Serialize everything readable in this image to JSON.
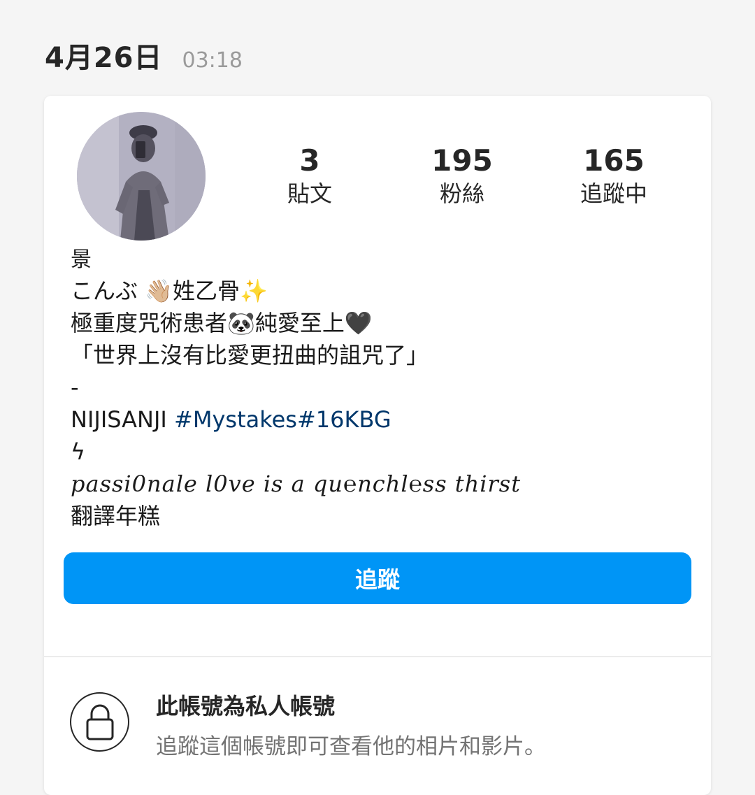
{
  "header": {
    "date": "4月26日",
    "time": "03:18"
  },
  "profile": {
    "avatar_icon": "profile-photo",
    "stats": {
      "posts_count": "3",
      "posts_label": "貼文",
      "followers_count": "195",
      "followers_label": "粉絲",
      "following_count": "165",
      "following_label": "追蹤中"
    },
    "bio": {
      "name": "景",
      "line1": "こんぶ 👋🏼姓乙骨✨",
      "line2": "極重度咒術患者🐼純愛至上🖤",
      "line3": "「世界上沒有比愛更扭曲的詛咒了」",
      "line4": "-",
      "line5_prefix": "NIJISANJI ",
      "line5_hashtags": "#Mystakes#16KBG",
      "line6": "ϟ",
      "line7": "passi0nale l0ve is a qu℮nchl℮ss thirst",
      "translate_link": "翻譯年糕"
    },
    "follow_button": "追蹤",
    "colors": {
      "follow_button": "#0095f6",
      "hashtag": "#00376b"
    }
  },
  "private_notice": {
    "icon": "lock-icon",
    "title": "此帳號為私人帳號",
    "description": "追蹤這個帳號即可查看他的相片和影片。"
  }
}
